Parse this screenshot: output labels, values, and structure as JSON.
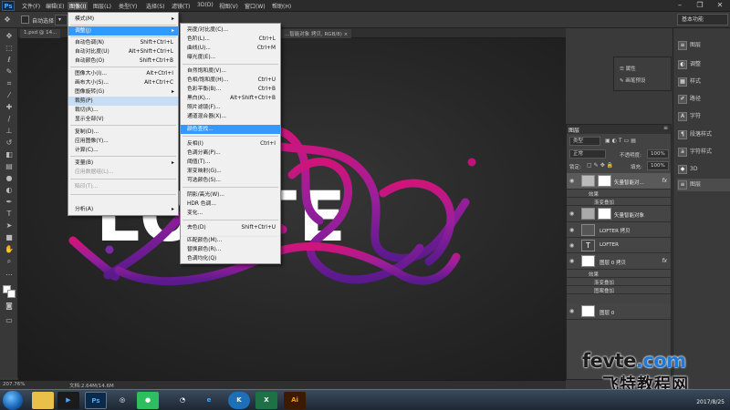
{
  "app": {
    "logo": "Ps"
  },
  "menubar": {
    "items": [
      "文件(F)",
      "编辑(E)",
      "图像(I)",
      "图层(L)",
      "类型(Y)",
      "选择(S)",
      "滤镜(T)",
      "3D(D)",
      "视图(V)",
      "窗口(W)",
      "帮助(H)"
    ],
    "active_index": 2
  },
  "window_controls": {
    "minimize": "–",
    "restore": "❐",
    "close": "✕"
  },
  "options_bar": {
    "auto_select_label": "自动选择",
    "workspace": "基本功能"
  },
  "document_tabs": [
    "1.psd @ 14...",
    "...智能对象 拷贝, RGB/8) ×"
  ],
  "image_menu": {
    "items": [
      {
        "label": "模式(M)",
        "shortcut": "",
        "submenu": true,
        "disabled": false
      },
      {
        "separator": true
      },
      {
        "label": "调整(J)",
        "shortcut": "",
        "submenu": true,
        "state": "selected"
      },
      {
        "separator": true
      },
      {
        "label": "自动色调(N)",
        "shortcut": "Shift+Ctrl+L"
      },
      {
        "label": "自动对比度(U)",
        "shortcut": "Alt+Shift+Ctrl+L"
      },
      {
        "label": "自动颜色(O)",
        "shortcut": "Shift+Ctrl+B"
      },
      {
        "separator": true
      },
      {
        "label": "图像大小(I)...",
        "shortcut": "Alt+Ctrl+I"
      },
      {
        "label": "画布大小(S)...",
        "shortcut": "Alt+Ctrl+C"
      },
      {
        "label": "图像旋转(G)",
        "shortcut": "",
        "submenu": true
      },
      {
        "label": "裁剪(P)",
        "shortcut": "",
        "state": "hover"
      },
      {
        "label": "裁切(R)...",
        "shortcut": ""
      },
      {
        "label": "显示全部(V)",
        "shortcut": ""
      },
      {
        "separator": true
      },
      {
        "label": "复制(D)...",
        "shortcut": ""
      },
      {
        "label": "应用图像(Y)...",
        "shortcut": ""
      },
      {
        "label": "计算(C)...",
        "shortcut": ""
      },
      {
        "separator": true
      },
      {
        "label": "变量(B)",
        "shortcut": "",
        "submenu": true
      },
      {
        "label": "应用数据组(L)...",
        "shortcut": "",
        "disabled": true
      },
      {
        "separator": true
      },
      {
        "label": "陷印(T)...",
        "shortcut": "",
        "disabled": true
      },
      {
        "separator": true
      },
      {
        "label": "分析(A)",
        "shortcut": "",
        "submenu": true
      }
    ]
  },
  "adjust_menu": {
    "items": [
      {
        "label": "亮度/对比度(C)...",
        "shortcut": ""
      },
      {
        "label": "色阶(L)...",
        "shortcut": "Ctrl+L"
      },
      {
        "label": "曲线(U)...",
        "shortcut": "Ctrl+M"
      },
      {
        "label": "曝光度(E)...",
        "shortcut": ""
      },
      {
        "separator": true
      },
      {
        "label": "自然饱和度(V)...",
        "shortcut": ""
      },
      {
        "label": "色相/饱和度(H)...",
        "shortcut": "Ctrl+U"
      },
      {
        "label": "色彩平衡(B)...",
        "shortcut": "Ctrl+B"
      },
      {
        "label": "黑白(K)...",
        "shortcut": "Alt+Shift+Ctrl+B"
      },
      {
        "label": "照片滤镜(F)...",
        "shortcut": ""
      },
      {
        "label": "通道混合器(X)...",
        "shortcut": ""
      },
      {
        "label": "颜色查找...",
        "shortcut": "",
        "state": "selected"
      },
      {
        "separator": true
      },
      {
        "label": "反相(I)",
        "shortcut": "Ctrl+I"
      },
      {
        "label": "色调分离(P)...",
        "shortcut": ""
      },
      {
        "label": "阈值(T)...",
        "shortcut": ""
      },
      {
        "label": "渐变映射(G)...",
        "shortcut": ""
      },
      {
        "label": "可选颜色(S)...",
        "shortcut": ""
      },
      {
        "separator": true
      },
      {
        "label": "阴影/高光(W)...",
        "shortcut": ""
      },
      {
        "label": "HDR 色调...",
        "shortcut": ""
      },
      {
        "label": "变化...",
        "shortcut": ""
      },
      {
        "separator": true
      },
      {
        "label": "去色(D)",
        "shortcut": "Shift+Ctrl+U"
      },
      {
        "label": "匹配颜色(M)...",
        "shortcut": ""
      },
      {
        "label": "替换颜色(R)...",
        "shortcut": ""
      },
      {
        "label": "色调均化(Q)",
        "shortcut": ""
      }
    ]
  },
  "mini_panel": {
    "item1": "属性",
    "item2": "画笔预设"
  },
  "dock_right": {
    "items": [
      "图层",
      "调整",
      "样式",
      "路径",
      "字符",
      "段落样式",
      "字符样式",
      "3D",
      "图层"
    ]
  },
  "layers_panel": {
    "tab": "图层",
    "kind_filter": "类型",
    "blend_mode": "正常",
    "opacity_label": "不透明度:",
    "opacity_value": "100%",
    "lock_label": "锁定:",
    "fill_label": "填充:",
    "fill_value": "100%",
    "rows": [
      {
        "name": "矢量智能对... ",
        "fx": "fx",
        "selected": true
      },
      {
        "name": "效果",
        "sub": true
      },
      {
        "name": "渐变叠加",
        "sub": true
      },
      {
        "name": "矢量智能对象",
        "fx": ""
      },
      {
        "name": "LOFTER 拷贝",
        "fx": ""
      },
      {
        "name": "LOFTER",
        "fx": ""
      },
      {
        "name": "图层 0 拷贝",
        "fx": "fx"
      },
      {
        "name": "效果",
        "sub": true
      },
      {
        "name": "渐变叠加",
        "sub": true
      },
      {
        "name": "图案叠加",
        "sub": true
      },
      {
        "name": "图层 0",
        "fx": ""
      }
    ],
    "type_glyph": "T"
  },
  "status_bar": {
    "zoom": "207.76%",
    "doc": "文档:2.64M/14.6M"
  },
  "taskbar": {
    "apps": [
      "",
      "Ps",
      "",
      "",
      "",
      "e",
      "K",
      "X",
      "Ai"
    ],
    "clock": "2017/8/25"
  },
  "canvas_art": {
    "text": "LOFTE",
    "colors": {
      "magenta": "#c1127a",
      "purple": "#6a1a9a",
      "violet": "#8a2bb0"
    }
  },
  "watermark": {
    "line1_a": "fevte",
    "line1_b": ".com",
    "line2": "飞特教程网"
  }
}
